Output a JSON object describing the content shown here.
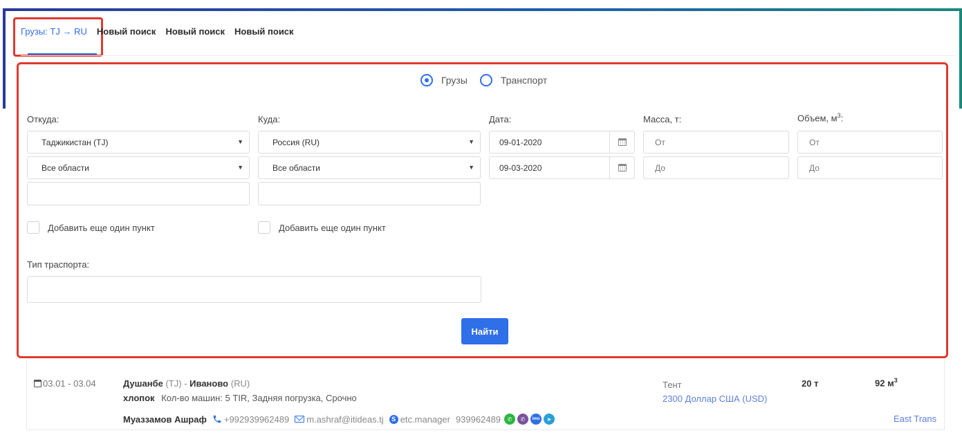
{
  "tabs": [
    {
      "label": "Грузы: TJ → RU",
      "active": true
    },
    {
      "label": "Новый поиск",
      "active": false
    },
    {
      "label": "Новый поиск",
      "active": false
    },
    {
      "label": "Новый поиск",
      "active": false
    }
  ],
  "search_type": {
    "options": [
      "Грузы",
      "Транспорт"
    ],
    "selected": "Грузы"
  },
  "form": {
    "from": {
      "label": "Откуда:",
      "country": "Таджикистан (TJ)",
      "region": "Все области",
      "city": ""
    },
    "to": {
      "label": "Куда:",
      "country": "Россия (RU)",
      "region": "Все области",
      "city": ""
    },
    "date": {
      "label": "Дата:",
      "from": "09-01-2020",
      "to": "09-03-2020"
    },
    "mass": {
      "label": "Масса, т:",
      "from_placeholder": "От",
      "to_placeholder": "До"
    },
    "volume": {
      "label_text": "Объем, м",
      "label_sup": "3",
      "label_suffix": ":",
      "from_placeholder": "От",
      "to_placeholder": "До"
    },
    "add_point_label": "Добавить еще один пункт",
    "transport_type": {
      "label": "Тип траспорта:",
      "value": ""
    },
    "submit_label": "Найти"
  },
  "result": {
    "dates": "03.01 - 03.04",
    "origin_city": "Душанбе",
    "origin_country": "(TJ)",
    "dash": "-",
    "dest_city": "Иваново",
    "dest_country": "(RU)",
    "cargo": "хлопок",
    "details": "Кол-во машин: 5  TIR, Задняя погрузка, Срочно",
    "contact_name": "Муаззамов Ашраф",
    "phone": "+992939962489",
    "email": "m.ashraf@itideas.tj",
    "skype": "etc.manager",
    "messenger_phone": "939962489",
    "body_type": "Тент",
    "price": "2300 Доллар США (USD)",
    "weight": "20 т",
    "volume_value": "92 м",
    "volume_sup": "3",
    "company": "East Trans",
    "messenger_icons": [
      "whatsapp-icon",
      "viber-icon",
      "imo-icon",
      "telegram-icon"
    ],
    "colors": {
      "whatsapp": "#2bb741",
      "viber": "#7b519d",
      "imo": "#2f6fe8",
      "telegram": "#2a9fd8"
    }
  }
}
